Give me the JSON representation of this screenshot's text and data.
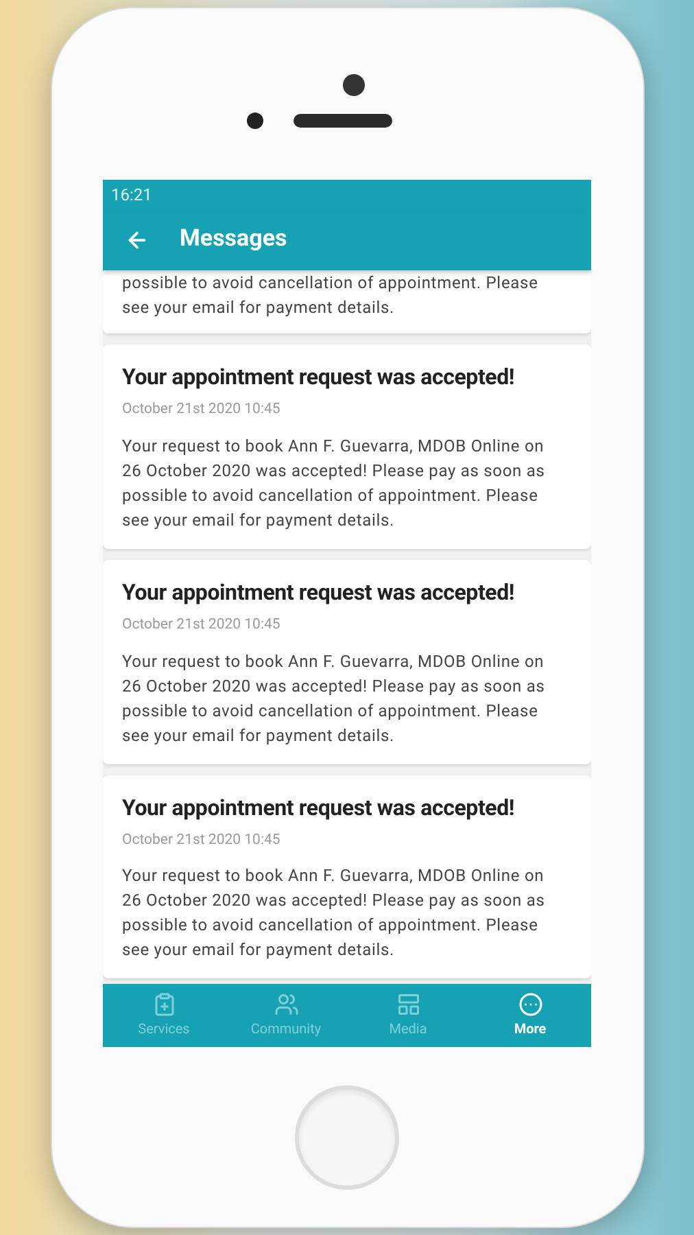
{
  "status_bar": {
    "time": "16:21"
  },
  "app_bar": {
    "title": "Messages"
  },
  "partial_message": {
    "body": "possible to avoid cancellation of appointment. Please see your email for payment details."
  },
  "messages": [
    {
      "title": "Your appointment request was accepted!",
      "date": "October 21st 2020 10:45",
      "body": "Your request to book Ann F. Guevarra, MDOB Online on 26 October 2020 was accepted! Please pay as soon as possible to avoid cancellation of appointment. Please see your email for payment details."
    },
    {
      "title": "Your appointment request was accepted!",
      "date": "October 21st 2020 10:45",
      "body": "Your request to book Ann F. Guevarra, MDOB Online on 26 October 2020 was accepted! Please pay as soon as possible to avoid cancellation of appointment. Please see your email for payment details."
    },
    {
      "title": "Your appointment request was accepted!",
      "date": "October 21st 2020 10:45",
      "body": "Your request to book Ann F. Guevarra, MDOB Online on 26 October 2020 was accepted! Please pay as soon as possible to avoid cancellation of appointment. Please see your email for payment details."
    }
  ],
  "bottom_nav": [
    {
      "label": "Services",
      "kind": "services",
      "selected": false
    },
    {
      "label": "Community",
      "kind": "community",
      "selected": false
    },
    {
      "label": "Media",
      "kind": "media",
      "selected": false
    },
    {
      "label": "More",
      "kind": "more",
      "selected": true
    }
  ]
}
